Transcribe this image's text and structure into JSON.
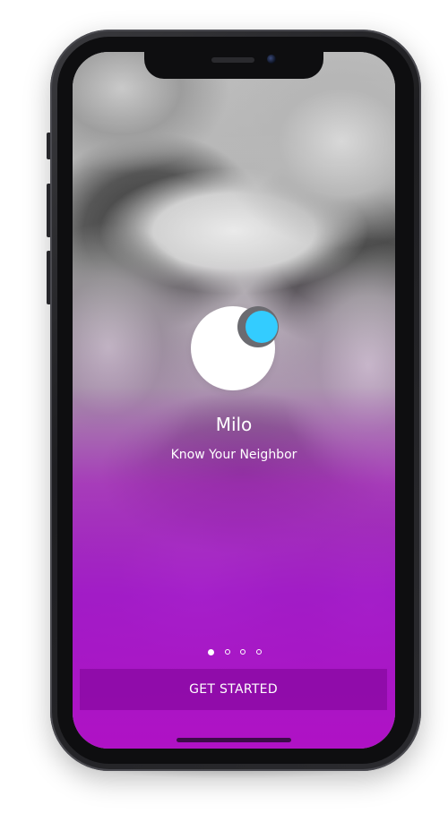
{
  "app": {
    "name": "Milo",
    "tagline": "Know Your Neighbor"
  },
  "onboarding": {
    "page_count": 4,
    "active_page": 1
  },
  "cta": {
    "label": "GET STARTED"
  },
  "colors": {
    "accent_dot": "#33ccff",
    "gradient_purple": "#b20fc8",
    "button_bg": "#8c0aa5",
    "text": "#ffffff"
  },
  "icons": {
    "logo": "milo-logo-icon"
  }
}
